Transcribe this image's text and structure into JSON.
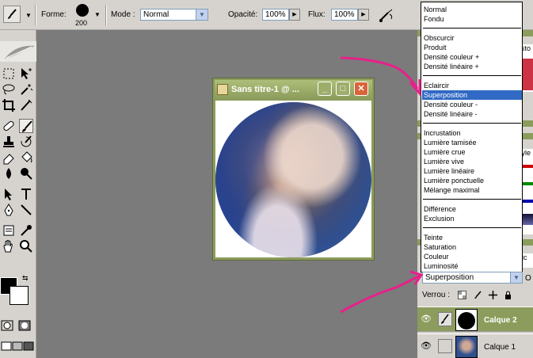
{
  "options_bar": {
    "forme_label": "Forme:",
    "brush_size": "200",
    "mode_label": "Mode :",
    "mode_value": "Normal",
    "opacity_label": "Opacité:",
    "opacity_value": "100%",
    "flux_label": "Flux:",
    "flux_value": "100%"
  },
  "document": {
    "title": "Sans titre-1 @ ..."
  },
  "blend_modes": {
    "groups": [
      [
        "Normal",
        "Fondu"
      ],
      [
        "Obscurcir",
        "Produit",
        "Densité couleur +",
        "Densité linéaire +"
      ],
      [
        "Eclaircir",
        "Superposition",
        "Densité couleur -",
        "Densité linéaire -"
      ],
      [
        "Incrustation",
        "Lumière tamisée",
        "Lumière crue",
        "Lumière vive",
        "Lumière linéaire",
        "Lumière ponctuelle",
        "Mélange maximal"
      ],
      [
        "Différence",
        "Exclusion"
      ],
      [
        "Teinte",
        "Saturation",
        "Couleur",
        "Luminosité"
      ]
    ],
    "highlighted": "Superposition",
    "selected_value": "Superposition"
  },
  "layers_panel": {
    "opacity_abbrev": "O",
    "lock_label": "Verrou :",
    "layers": [
      {
        "name": "Calque 2",
        "active": true
      },
      {
        "name": "Calque 1",
        "active": false
      }
    ]
  },
  "side_tabs": {
    "history_tab": "isto",
    "styles_tab": "tyle",
    "paths_tab": "ric"
  },
  "colors": {
    "annotation_arrow": "#e8208a",
    "selection": "#316ac5",
    "window_frame": "#8c9c5c",
    "close_button": "#d9643a"
  }
}
